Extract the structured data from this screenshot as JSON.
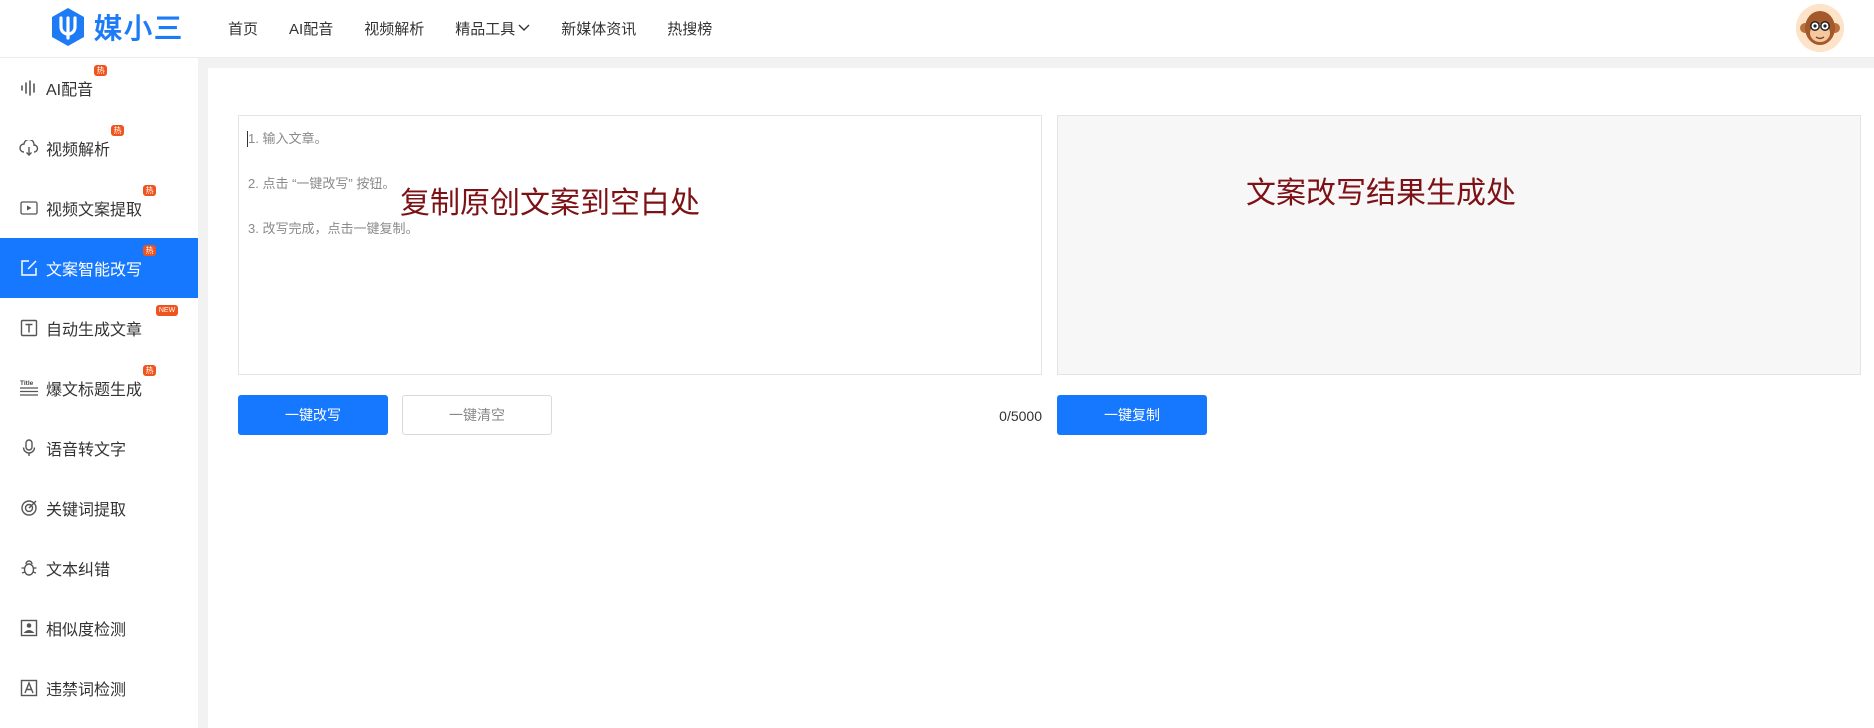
{
  "header": {
    "logo_text": "媒小三",
    "nav": [
      {
        "label": "首页"
      },
      {
        "label": "AI配音"
      },
      {
        "label": "视频解析"
      },
      {
        "label": "精品工具"
      },
      {
        "label": "新媒体资讯"
      },
      {
        "label": "热搜榜"
      }
    ]
  },
  "sidebar": {
    "items": [
      {
        "label": "AI配音",
        "badge": "热",
        "icon": "waveform-icon"
      },
      {
        "label": "视频解析",
        "badge": "热",
        "icon": "cloud-download-icon"
      },
      {
        "label": "视频文案提取",
        "badge": "热",
        "icon": "video-icon"
      },
      {
        "label": "文案智能改写",
        "badge": "热",
        "icon": "edit-icon",
        "active": true
      },
      {
        "label": "自动生成文章",
        "badge": "NEW",
        "icon": "text-box-icon"
      },
      {
        "label": "爆文标题生成",
        "badge": "热",
        "icon": "title-icon"
      },
      {
        "label": "语音转文字",
        "badge": "",
        "icon": "microphone-icon"
      },
      {
        "label": "关键词提取",
        "badge": "",
        "icon": "target-icon"
      },
      {
        "label": "文本纠错",
        "badge": "",
        "icon": "bug-icon"
      },
      {
        "label": "相似度检测",
        "badge": "",
        "icon": "image-compare-icon"
      },
      {
        "label": "违禁词检测",
        "badge": "",
        "icon": "forbidden-word-icon"
      }
    ]
  },
  "editor": {
    "placeholder_lines": [
      "1. 输入文章。",
      "2. 点击 “一键改写” 按钮。",
      "3. 改写完成，点击一键复制。"
    ],
    "overlay_left": "复制原创文案到空白处",
    "overlay_right": "文案改写结果生成处",
    "rewrite_button": "一键改写",
    "clear_button": "一键清空",
    "counter": "0/5000",
    "copy_button": "一键复制"
  },
  "colors": {
    "accent": "#1677ff",
    "badge": "#f0541e",
    "overlay_text": "#7d1216"
  }
}
